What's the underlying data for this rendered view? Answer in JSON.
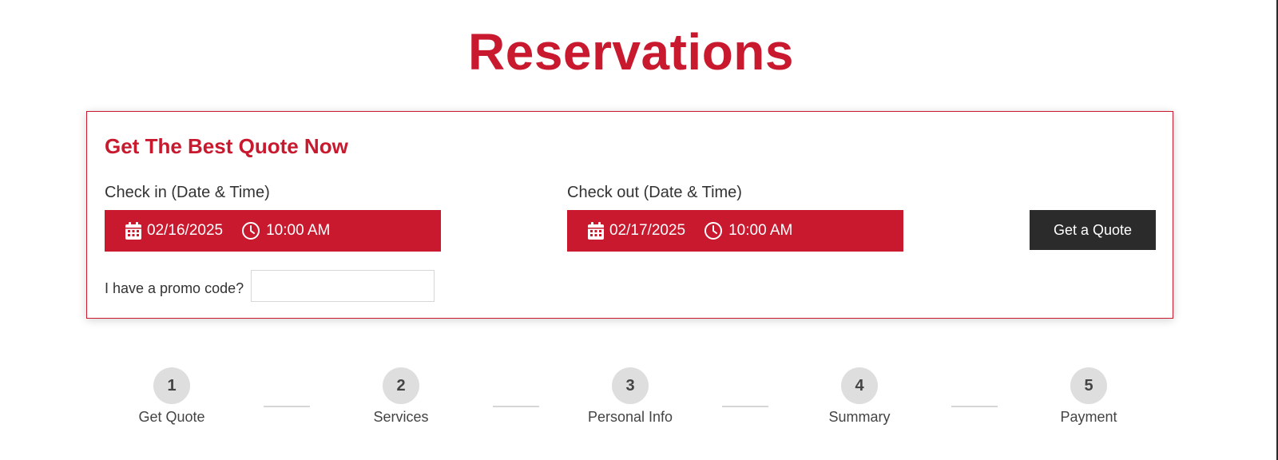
{
  "page": {
    "title": "Reservations"
  },
  "quote_card": {
    "heading": "Get The Best Quote Now",
    "check_in": {
      "label": "Check in (Date & Time)",
      "date": "02/16/2025",
      "time": "10:00 AM"
    },
    "check_out": {
      "label": "Check out (Date & Time)",
      "date": "02/17/2025",
      "time": "10:00 AM"
    },
    "quote_button_label": "Get a Quote",
    "promo": {
      "label": "I have a promo code?",
      "value": ""
    }
  },
  "steps": [
    {
      "number": "1",
      "label": "Get Quote"
    },
    {
      "number": "2",
      "label": "Services"
    },
    {
      "number": "3",
      "label": "Personal Info"
    },
    {
      "number": "4",
      "label": "Summary"
    },
    {
      "number": "5",
      "label": "Payment"
    }
  ],
  "colors": {
    "accent": "#c8192e",
    "button_dark": "#2b2b2b",
    "step_circle": "#dedede"
  },
  "icons": [
    "calendar-icon",
    "clock-icon"
  ]
}
